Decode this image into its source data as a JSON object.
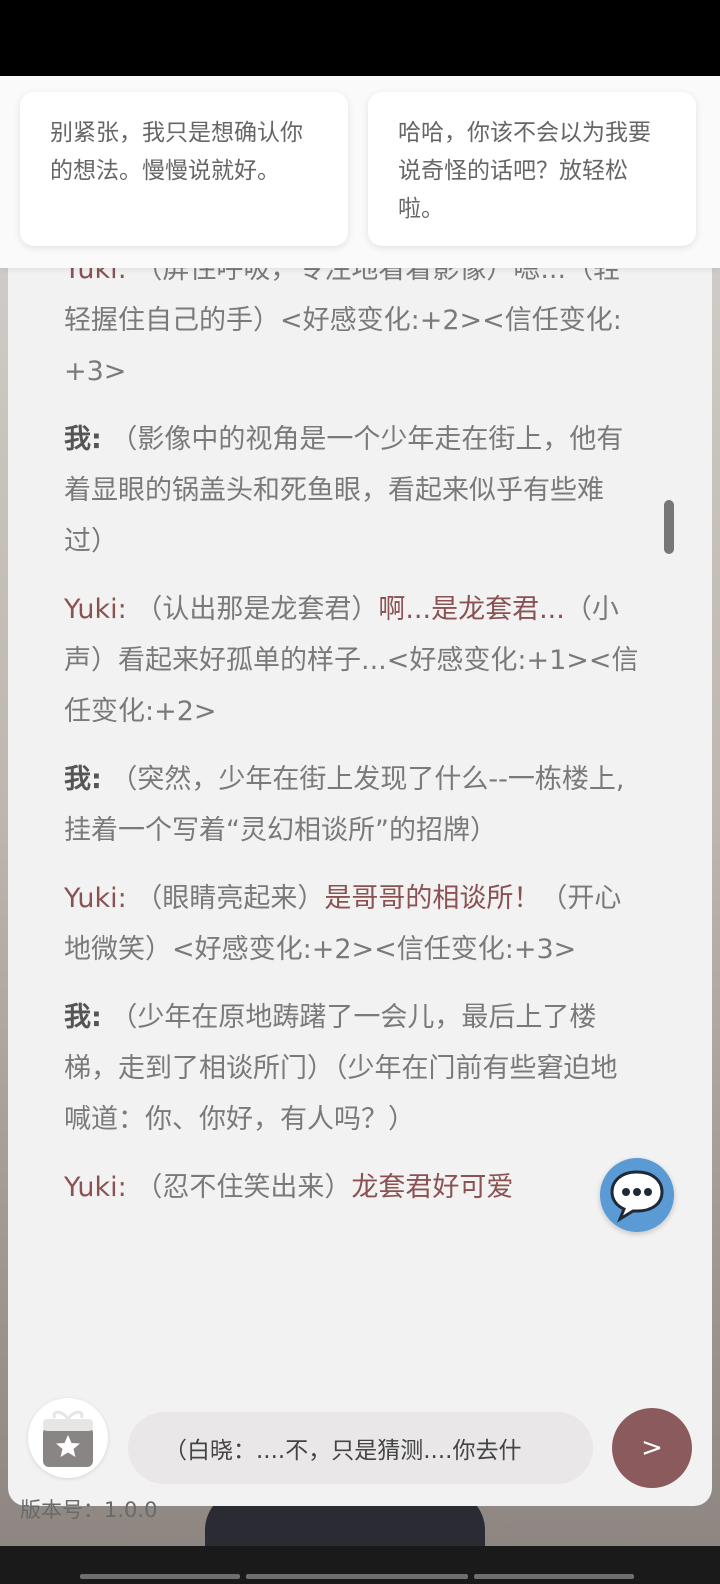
{
  "suggestions": [
    {
      "text": "别紧张，我只是想确认你的想法。慢慢说就好。"
    },
    {
      "text": "哈哈，你该不会以为我要说奇怪的话吧？放轻松啦。"
    }
  ],
  "messages": [
    {
      "speaker": "Yuki:",
      "narration1": "（屏住呼吸，专注地看着影像）",
      "speech": "",
      "narration2": "嗯...（轻轻握住自己的手）<好感变化:+2><信任变化:+3>"
    },
    {
      "speaker": "我:",
      "narration1": "（影像中的视角是一个少年走在街上，他有着显眼的锅盖头和死鱼眼，看起来似乎有些难过）",
      "speech": "",
      "narration2": ""
    },
    {
      "speaker": "Yuki:",
      "narration1": "（认出那是龙套君）",
      "speech": "啊...是龙套君...",
      "narration2": "（小声）看起来好孤单的样子...<好感变化:+1><信任变化:+2>"
    },
    {
      "speaker": "我:",
      "narration1": "（突然，少年在街上发现了什么--一栋楼上,挂着一个写着“灵幻相谈所”的招牌）",
      "speech": "",
      "narration2": ""
    },
    {
      "speaker": "Yuki:",
      "narration1": "（眼睛亮起来）",
      "speech": "是哥哥的相谈所！",
      "narration2": "（开心地微笑）<好感变化:+2><信任变化:+3>"
    },
    {
      "speaker": "我:",
      "narration1": "（少年在原地踌躇了一会儿，最后上了楼梯，走到了相谈所门）（少年在门前有些窘迫地喊道：你、你好，有人吗？）",
      "speech": "",
      "narration2": ""
    },
    {
      "speaker": "Yuki:",
      "narration1": "（忍不住笑出来）",
      "speech": "龙套君好可爱",
      "narration2": ""
    }
  ],
  "input": {
    "value": "（白晓：....不，只是猜测....你去什"
  },
  "send_label": ">",
  "version_label": "版本号：1.0.0",
  "icons": {
    "chat": "chat-bubble-icon",
    "gift": "gift-icon",
    "star": "star-icon"
  },
  "colors": {
    "accent": "#8b5a5c",
    "yuki": "#8b5253",
    "fab": "#5b9bd5"
  }
}
